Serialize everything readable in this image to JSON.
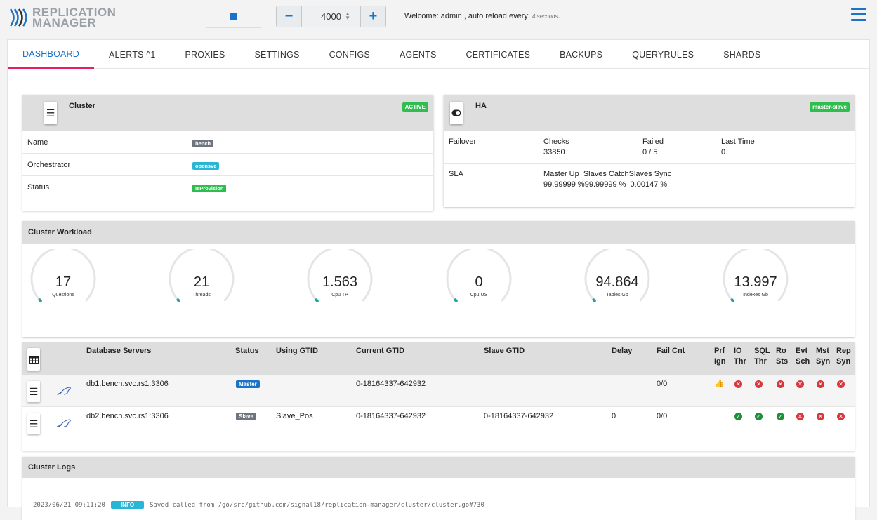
{
  "app": {
    "logo_line1": "REPLICATION",
    "logo_line2": "MANAGER"
  },
  "toolbar": {
    "stepper_value": "4000",
    "minus": "−",
    "plus": "+",
    "welcome_prefix": "Welcome: admin , auto reload every: ",
    "welcome_interval": "4 seconds",
    "welcome_suffix": "."
  },
  "tabs": [
    "DASHBOARD",
    "ALERTS ^1",
    "PROXIES",
    "SETTINGS",
    "CONFIGS",
    "AGENTS",
    "CERTIFICATES",
    "BACKUPS",
    "QUERYRULES",
    "SHARDS"
  ],
  "cluster_card": {
    "title": "Cluster",
    "badge": "ACTIVE",
    "rows": [
      {
        "label": "Name",
        "value": "bench",
        "color": "#6c757d"
      },
      {
        "label": "Orchestrator",
        "value": "opensvc",
        "color": "#29b6d6"
      },
      {
        "label": "Status",
        "value": "IsProvision",
        "color": "#2ebd4e"
      }
    ]
  },
  "ha_card": {
    "title": "HA",
    "badge": "master-slave",
    "failover_label": "Failover",
    "checks_label": "Checks",
    "checks_value": "33850",
    "failed_label": "Failed",
    "failed_value": "0 / 5",
    "last_time_label": "Last Time",
    "last_time_value": "0",
    "sla_label": "SLA",
    "sla_header": "Master Up  Slaves CatchSlaves Sync",
    "sla_values": "99.99999 %99.99999 %  0.00147 %"
  },
  "workload": {
    "title": "Cluster Workload",
    "gauges": [
      {
        "value": "17",
        "label": "Questions"
      },
      {
        "value": "21",
        "label": "Threads"
      },
      {
        "value": "1.563",
        "label": "Cpu TP"
      },
      {
        "value": "0",
        "label": "Cpu US"
      },
      {
        "value": "94.864",
        "label": "Tables Gb"
      },
      {
        "value": "13.997",
        "label": "Indexes Gb"
      }
    ]
  },
  "servers": {
    "headers": {
      "db": "Database Servers",
      "status": "Status",
      "gtid": "Using GTID",
      "cur": "Current GTID",
      "slave": "Slave GTID",
      "delay": "Delay",
      "fail": "Fail Cnt",
      "prf": [
        "Prf",
        "Ign"
      ],
      "io": [
        "IO",
        "Thr"
      ],
      "sql": [
        "SQL",
        "Thr"
      ],
      "ro": [
        "Ro",
        "Sts"
      ],
      "evt": [
        "Evt",
        "Sch"
      ],
      "mst": [
        "Mst",
        "Syn"
      ],
      "rep": [
        "Rep",
        "Syn"
      ]
    },
    "rows": [
      {
        "host": "db1.bench.svc.rs1:3306",
        "status": "Master",
        "status_color": "#1a73c8",
        "gtid": "",
        "current": "0-18164337-642932",
        "slave": "",
        "delay": "",
        "fail": "0/0",
        "flags": [
          "thumb",
          "ko",
          "ko",
          "ko",
          "ko",
          "ko",
          "ko"
        ]
      },
      {
        "host": "db2.bench.svc.rs1:3306",
        "status": "Slave",
        "status_color": "#6c757d",
        "gtid": "Slave_Pos",
        "current": "0-18164337-642932",
        "slave": "0-18164337-642932",
        "delay": "0",
        "fail": "0/0",
        "flags": [
          "",
          "ok",
          "ok",
          "ok",
          "ko",
          "ko",
          "ko"
        ]
      }
    ]
  },
  "logs": {
    "title": "Cluster Logs",
    "line": {
      "time": "2023/06/21 09:11:20",
      "level": "INFO",
      "text": "Saved called from /go/src/github.com/signal18/replication-manager/cluster/cluster.go#730"
    }
  },
  "colors": {
    "accent": "#1a73c8",
    "tab_underline": "#e91e63",
    "ok": "#1e8f3a",
    "ko": "#d9363e",
    "gauge_track": "#e5e5e5",
    "gauge_fill": "#1aa89a"
  }
}
